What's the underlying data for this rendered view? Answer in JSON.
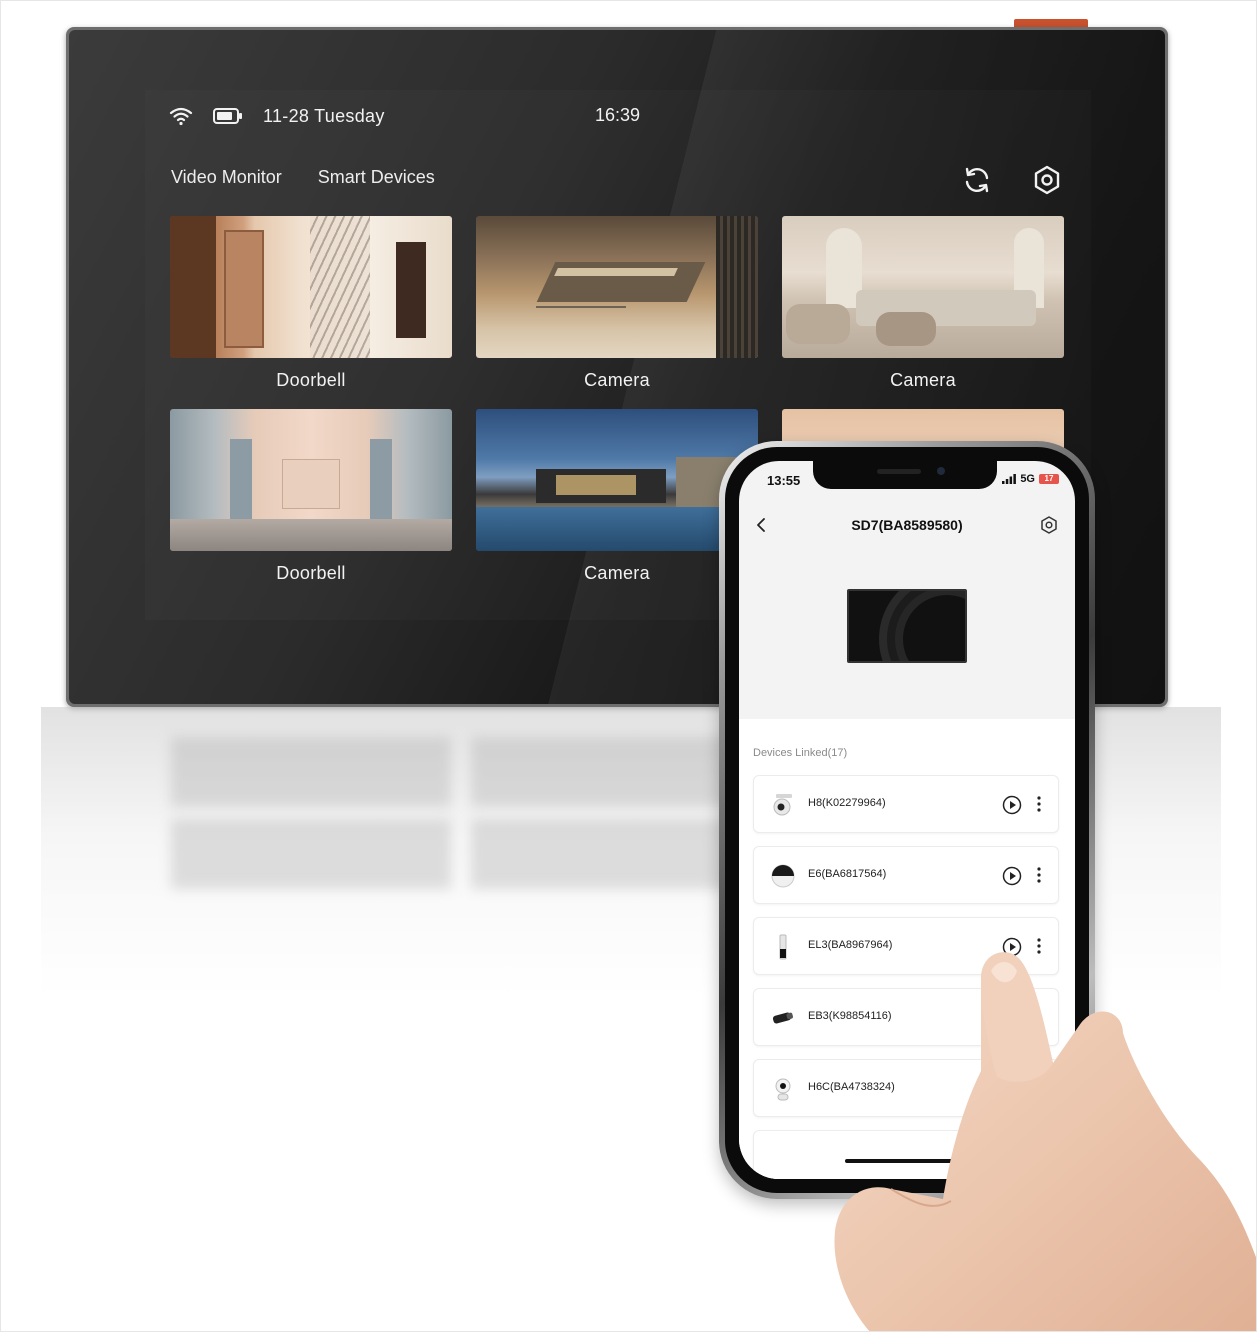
{
  "monitor": {
    "date": "11-28 Tuesday",
    "time": "16:39",
    "tabs": [
      "Video Monitor",
      "Smart Devices"
    ],
    "tiles": [
      {
        "label": "Doorbell"
      },
      {
        "label": "Camera"
      },
      {
        "label": "Camera"
      },
      {
        "label": "Doorbell"
      },
      {
        "label": "Camera"
      }
    ],
    "icons": [
      "wifi-icon",
      "battery-icon",
      "refresh-icon",
      "settings-hex-icon"
    ]
  },
  "phone": {
    "time": "13:55",
    "network": "5G",
    "battery": "17",
    "title": "SD7(BA8589580)",
    "devices_linked_label": "Devices Linked(17)",
    "devices": [
      {
        "name": "H8(K02279964)",
        "icon": "ptz-camera-icon"
      },
      {
        "name": "E6(BA6817564)",
        "icon": "dome-camera-icon"
      },
      {
        "name": "EL3(BA8967964)",
        "icon": "smart-lock-icon"
      },
      {
        "name": "EB3(K98854116)",
        "icon": "bullet-camera-icon"
      },
      {
        "name": "H6C(BA4738324)",
        "icon": "indoor-camera-icon"
      }
    ]
  },
  "colors": {
    "monitor_frame": "#6e6e6e",
    "monitor_screen": "#1a1a1a",
    "power_tab": "#c9512e",
    "phone_bg": "#f3f3f3",
    "battery_badge": "#e5554b"
  }
}
